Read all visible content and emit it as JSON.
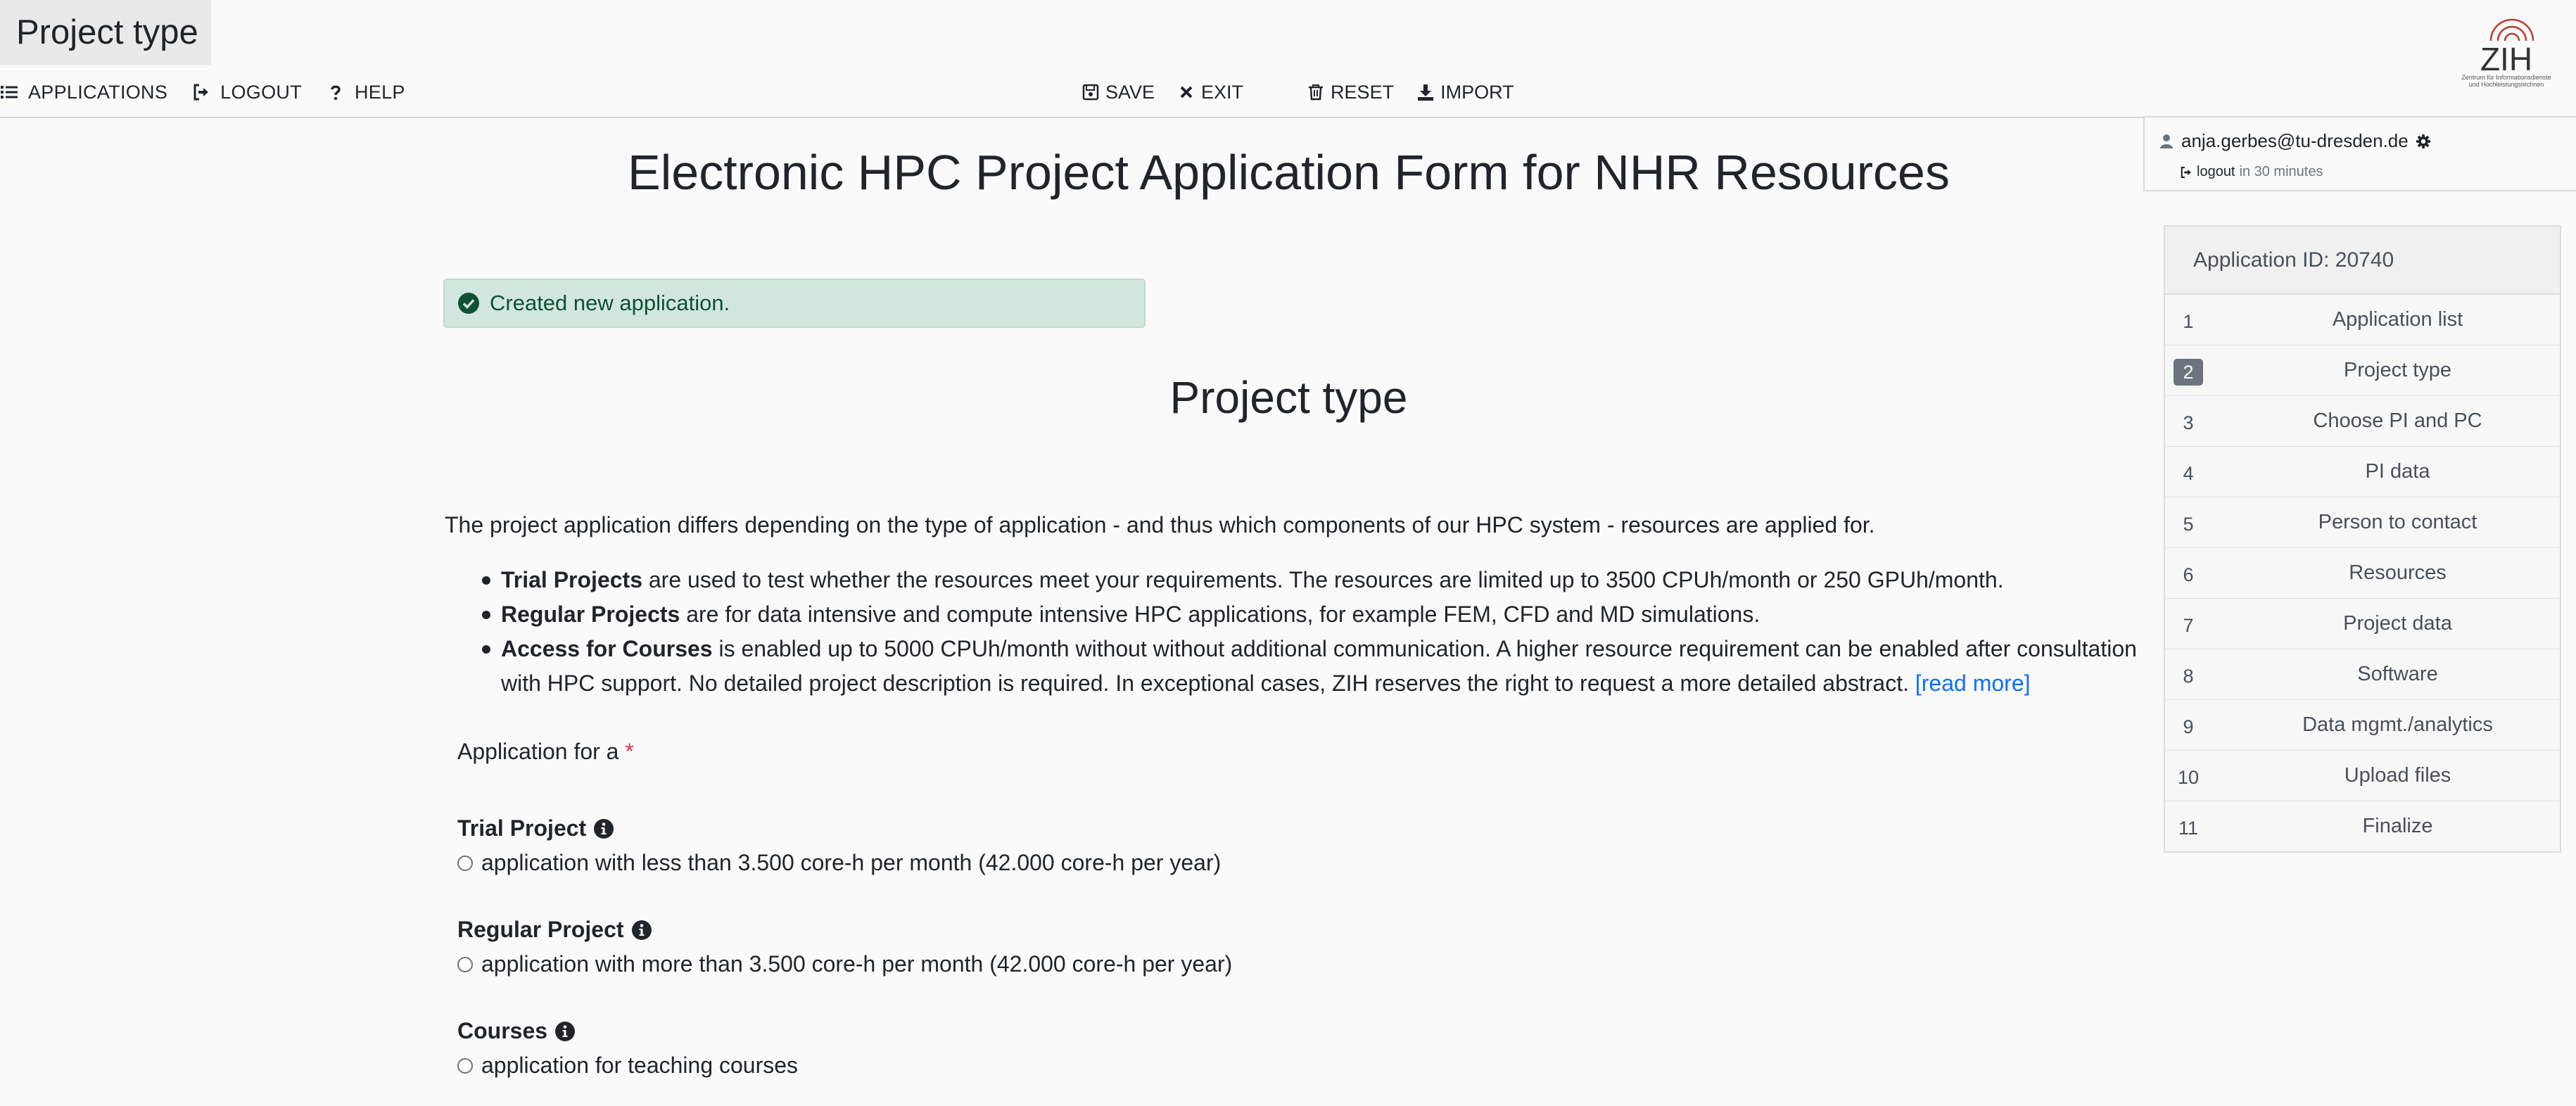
{
  "tab_title": "Project type",
  "nav": {
    "applications": "APPLICATIONS",
    "logout": "LOGOUT",
    "help": "HELP"
  },
  "toolbar": {
    "save": "SAVE",
    "exit": "EXIT",
    "reset": "RESET",
    "import": "IMPORT"
  },
  "logo": {
    "text": "ZIH",
    "subtitle_1": "Zentrum für Informationsdienste",
    "subtitle_2": "und Hochleistungsrechnen"
  },
  "user": {
    "email": "anja.gerbes@tu-dresden.de",
    "logout_label": "logout",
    "logout_timer": "in 30 minutes"
  },
  "sidebar": {
    "header": "Application ID: 20740",
    "active_step": 2,
    "steps": [
      {
        "num": "1",
        "label": "Application list"
      },
      {
        "num": "2",
        "label": "Project type"
      },
      {
        "num": "3",
        "label": "Choose PI and PC"
      },
      {
        "num": "4",
        "label": "PI data"
      },
      {
        "num": "5",
        "label": "Person to contact"
      },
      {
        "num": "6",
        "label": "Resources"
      },
      {
        "num": "7",
        "label": "Project data"
      },
      {
        "num": "8",
        "label": "Software"
      },
      {
        "num": "9",
        "label": "Data mgmt./analytics"
      },
      {
        "num": "10",
        "label": "Upload files"
      },
      {
        "num": "11",
        "label": "Finalize"
      }
    ]
  },
  "main": {
    "page_heading": "Electronic HPC Project Application Form for NHR Resources",
    "alert": "Created new application.",
    "section_heading": "Project type",
    "intro": "The project application differs depending on the type of application - and thus which components of our HPC system - resources are applied for.",
    "bullets": [
      {
        "bold": "Trial Projects",
        "text": " are used to test whether the resources meet your requirements. The resources are limited up to 3500 CPUh/month or 250 GPUh/month."
      },
      {
        "bold": "Regular Projects",
        "text": " are for data intensive and compute intensive HPC applications, for example FEM, CFD and MD simulations."
      },
      {
        "bold": "Access for Courses",
        "text": " is enabled up to 5000 CPUh/month without without additional communication. A higher resource requirement can be enabled after consultation with HPC support. No detailed project description is required. In exceptional cases, ZIH reserves the right to request a more detailed abstract. ",
        "link": "[read more]"
      }
    ],
    "application_for_label": "Application for a",
    "required_mark": "*",
    "options": [
      {
        "title": "Trial Project",
        "desc": "application with less than 3.500 core-h per month (42.000 core-h per year)"
      },
      {
        "title": "Regular Project",
        "desc": "application with more than 3.500 core-h per month (42.000 core-h per year)"
      },
      {
        "title": "Courses",
        "desc": "application for teaching courses"
      }
    ]
  },
  "colors": {
    "alert_bg": "#d1e7dd",
    "alert_text": "#0f5132",
    "link": "#0d6efd",
    "required": "#dc3545",
    "active_step_badge": "#6c757d",
    "logo_red": "#c0392b"
  }
}
